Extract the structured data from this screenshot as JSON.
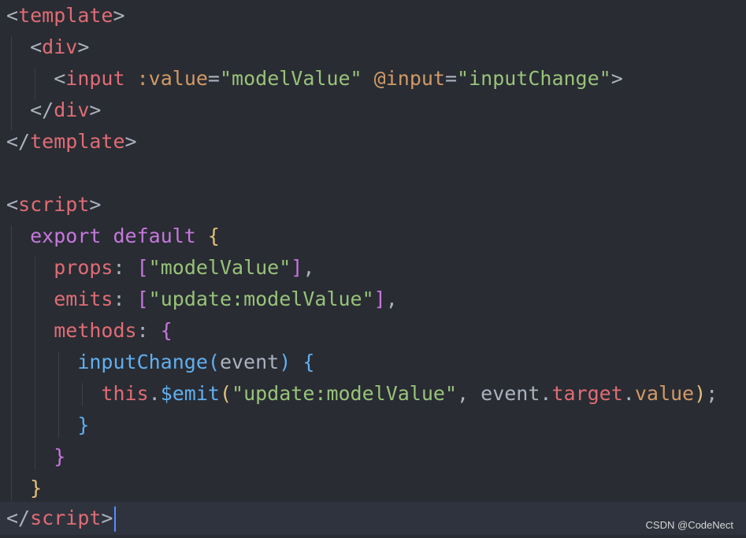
{
  "code": {
    "l1": {
      "lt": "<",
      "tag": "template",
      "gt": ">"
    },
    "l2": {
      "lt": "<",
      "tag": "div",
      "gt": ">"
    },
    "l3": {
      "lt": "<",
      "tag": "input",
      "attr1": ":value",
      "eq1": "=",
      "val1": "\"modelValue\"",
      "attr2": "@input",
      "eq2": "=",
      "val2": "\"inputChange\"",
      "gt": ">"
    },
    "l4": {
      "lt": "</",
      "tag": "div",
      "gt": ">"
    },
    "l5": {
      "lt": "</",
      "tag": "template",
      "gt": ">"
    },
    "l7": {
      "lt": "<",
      "tag": "script",
      "gt": ">"
    },
    "l8": {
      "kw1": "export",
      "kw2": "default",
      "brace": "{"
    },
    "l9": {
      "prop": "props",
      "colon": ":",
      "open": "[",
      "str": "\"modelValue\"",
      "close": "]",
      "comma": ","
    },
    "l10": {
      "prop": "emits",
      "colon": ":",
      "open": "[",
      "str": "\"update:modelValue\"",
      "close": "]",
      "comma": ","
    },
    "l11": {
      "prop": "methods",
      "colon": ":",
      "brace": "{"
    },
    "l12": {
      "fn": "inputChange",
      "open": "(",
      "arg": "event",
      "close": ")",
      "brace": "{"
    },
    "l13": {
      "this": "this",
      "dot1": ".",
      "fn": "$emit",
      "open": "(",
      "str": "\"update:modelValue\"",
      "comma": ",",
      "obj": "event",
      "dot2": ".",
      "p1": "target",
      "dot3": ".",
      "p2": "value",
      "close": ")",
      "semi": ";"
    },
    "l14": {
      "brace": "}"
    },
    "l15": {
      "brace": "}"
    },
    "l16": {
      "brace": "}"
    },
    "l17": {
      "lt": "</",
      "tag": "script",
      "gt": ">"
    }
  },
  "watermark": "CSDN @CodeNect"
}
